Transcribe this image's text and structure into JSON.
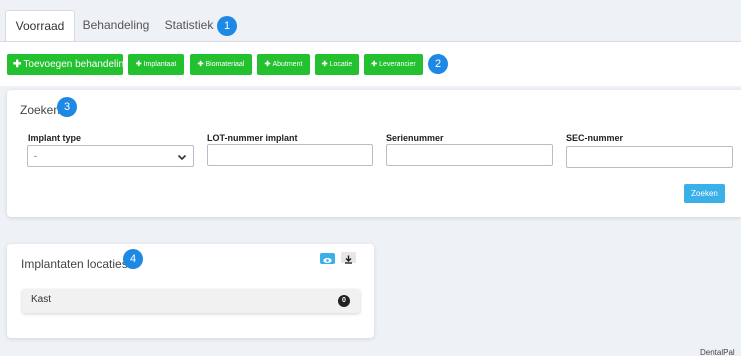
{
  "tabs": [
    {
      "label": "Voorraad",
      "active": true
    },
    {
      "label": "Behandeling",
      "active": false
    },
    {
      "label": "Statistiek",
      "active": false
    }
  ],
  "toolbar": {
    "main_button": "Toevoegen behandeling",
    "buttons": [
      "Implantaat",
      "Biomateriaal",
      "Abutment",
      "Locatie",
      "Leverancier"
    ]
  },
  "badges": [
    "1",
    "2",
    "3",
    "4"
  ],
  "search": {
    "title": "Zoeken",
    "fields": [
      {
        "label": "Implant type",
        "value": "-"
      },
      {
        "label": "LOT-nummer implant",
        "value": ""
      },
      {
        "label": "Serienummer",
        "value": ""
      },
      {
        "label": "SEC-nummer",
        "value": ""
      }
    ],
    "submit_label": "Zoeken"
  },
  "locations": {
    "title": "Implantaten locaties",
    "items": [
      {
        "label": "Kast",
        "count": "0"
      }
    ]
  },
  "footer": "DentalPal",
  "colors": {
    "green": "#23c030",
    "blue_button": "#39b0e8",
    "badge_blue": "#1e88e5"
  },
  "icons": [
    "plus-icon",
    "eye-icon",
    "download-icon",
    "chevron-down-icon"
  ]
}
